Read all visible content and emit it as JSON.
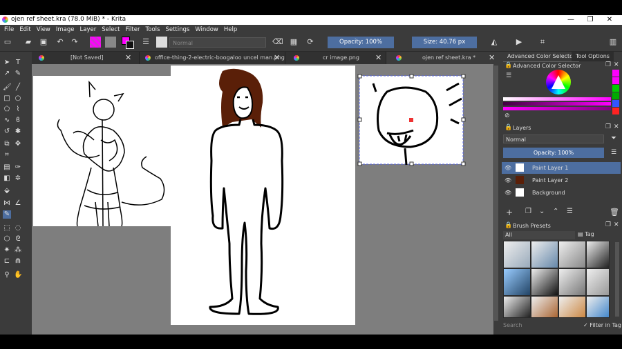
{
  "window": {
    "title": "ojen ref  sheet.kra (78.0 MiB)  * - Krita"
  },
  "menu": [
    "File",
    "Edit",
    "View",
    "Image",
    "Layer",
    "Select",
    "Filter",
    "Tools",
    "Settings",
    "Window",
    "Help"
  ],
  "toolbar": {
    "blend_mode": "Normal",
    "opacity_label": "Opacity: 100%",
    "size_label": "Size: 40.76 px",
    "opacity_value": 1.0,
    "fg_color": "#ff00ff",
    "bg_color": "#808080"
  },
  "tabs": [
    {
      "label": "[Not Saved]"
    },
    {
      "label": "office-thing-2-electric-boogaloo uncel man.png"
    },
    {
      "label": "cr image.png"
    },
    {
      "label": "ojen ref  sheet.kra *"
    }
  ],
  "docker": {
    "tabs": [
      "Advanced Color Selector",
      "Tool Options"
    ],
    "color_selector_title": "Advanced Color Selector",
    "layers_title": "Layers",
    "layers_blend": "Normal",
    "layers_opacity": "Opacity:  100%",
    "layers": [
      {
        "name": "Paint Layer 1",
        "selected": true
      },
      {
        "name": "Paint Layer 2",
        "selected": false
      },
      {
        "name": "Background",
        "selected": false
      }
    ],
    "brush_presets_title": "Brush Presets",
    "brush_filter": "All",
    "tag_label": "Tag",
    "search_placeholder": "Search",
    "filter_in_tag": "Filter in Tag",
    "swatch_colors": [
      "#ff00ff",
      "#ff00ff",
      "#00cc00",
      "#00aa00",
      "#3355ff",
      "#ff2222"
    ]
  }
}
